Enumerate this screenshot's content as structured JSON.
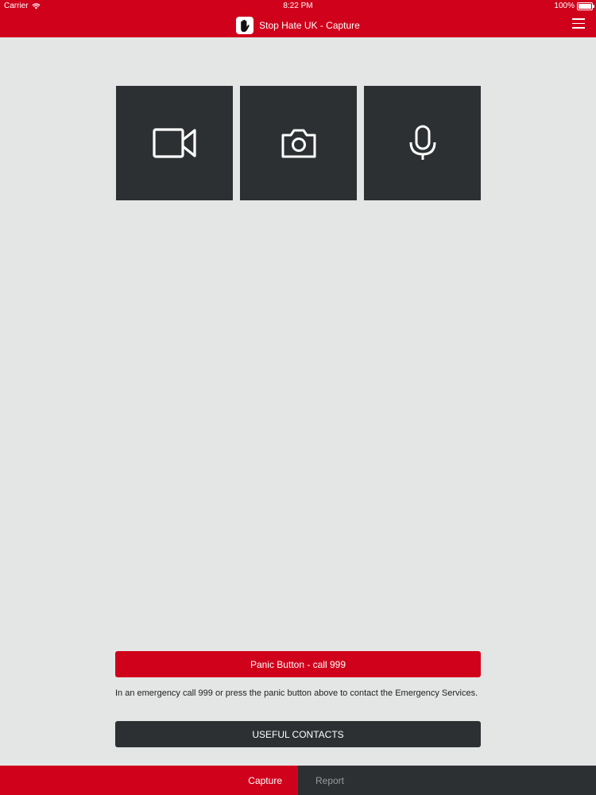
{
  "status_bar": {
    "carrier": "Carrier",
    "time": "8:22 PM",
    "battery": "100%",
    "battery_level": 1.0
  },
  "nav": {
    "title": "Stop Hate UK - Capture",
    "logo_icon": "hand-icon",
    "menu_icon": "hamburger-menu-icon"
  },
  "capture_buttons": [
    {
      "icon": "video-camera-icon"
    },
    {
      "icon": "camera-icon"
    },
    {
      "icon": "microphone-icon"
    }
  ],
  "panic": {
    "label": "Panic Button - call 999",
    "help_text": "In an emergency call 999 or press the panic button above to contact the Emergency Services."
  },
  "contacts": {
    "label": "USEFUL CONTACTS"
  },
  "tabs": [
    {
      "label": "Capture",
      "active": true
    },
    {
      "label": "Report",
      "active": false
    }
  ],
  "colors": {
    "brand_red": "#d0021b",
    "dark": "#2d3033",
    "background": "#e4e6e6"
  }
}
